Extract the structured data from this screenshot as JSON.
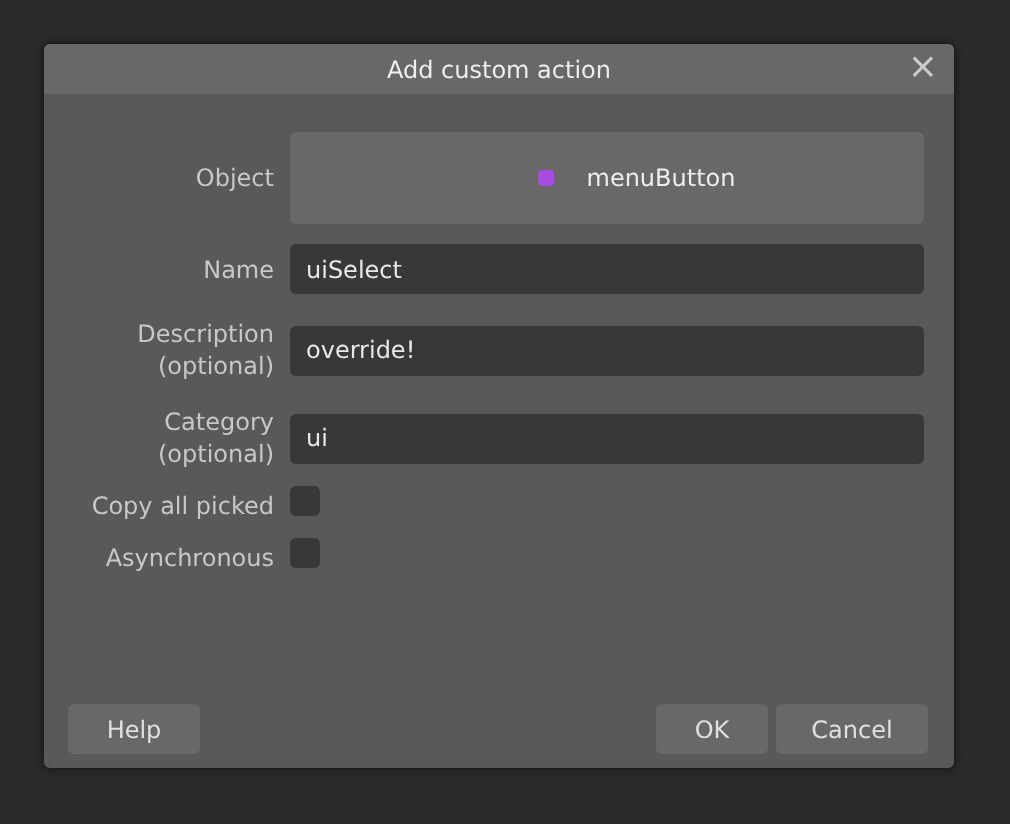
{
  "dialog": {
    "title": "Add custom action",
    "close": "×"
  },
  "fields": [
    {
      "kind": "object",
      "label": "Object",
      "value": "menuButton",
      "color": "#a64ce0"
    },
    {
      "kind": "text",
      "label": "Name",
      "value": "uiSelect"
    },
    {
      "kind": "text",
      "label": "Description\n(optional)",
      "value": "override!"
    },
    {
      "kind": "text",
      "label": "Category\n(optional)",
      "value": "ui"
    },
    {
      "kind": "checkbox",
      "label": "Copy all picked",
      "checked": false
    },
    {
      "kind": "checkbox",
      "label": "Asynchronous",
      "checked": false
    }
  ],
  "left_buttons": [
    "Help"
  ],
  "right_buttons": [
    "OK",
    "Cancel"
  ]
}
